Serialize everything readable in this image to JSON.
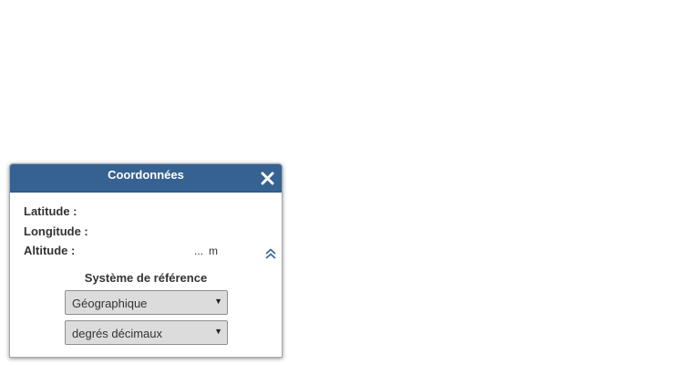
{
  "panel": {
    "title": "Coordonnées",
    "close_icon": "close-icon",
    "accent_color": "#366291"
  },
  "coordinates": {
    "latitude_label": "Latitude :",
    "longitude_label": "Longitude :",
    "altitude_label": "Altitude :",
    "altitude_value": "...",
    "altitude_unit": "m",
    "expand_icon": "double-chevron-up-icon"
  },
  "reference": {
    "title": "Système de référence",
    "system_selected": "Géographique",
    "unit_selected": "degrés décimaux"
  }
}
